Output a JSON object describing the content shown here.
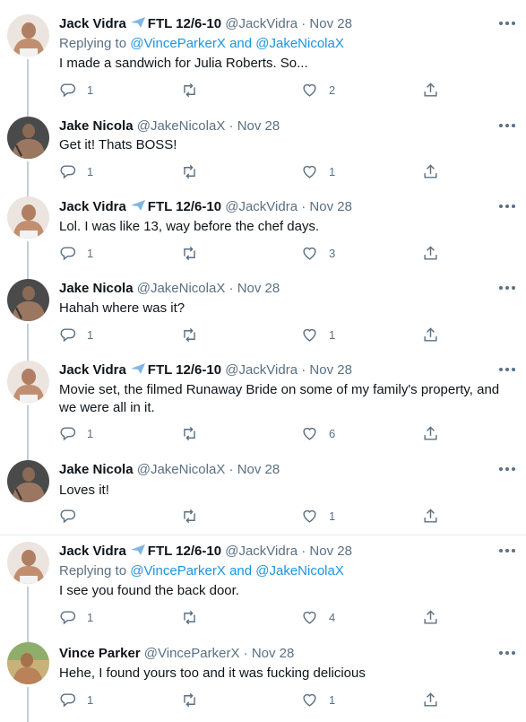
{
  "tweets": [
    {
      "name": "Jack Vidra",
      "name_suffix": "FTL 12/6-10",
      "has_plane": true,
      "handle": "@JackVidra",
      "date": "Nov 28",
      "replying_prefix": "Replying to",
      "replying_a": "@VinceParkerX",
      "replying_and": "and",
      "replying_b": "@JakeNicolaX",
      "text": "I made a sandwich for Julia Roberts. So...",
      "replies": "1",
      "retweets": "",
      "likes": "2"
    },
    {
      "name": "Jake Nicola",
      "handle": "@JakeNicolaX",
      "date": "Nov 28",
      "text": "Get it! Thats BOSS!",
      "replies": "1",
      "retweets": "",
      "likes": "1"
    },
    {
      "name": "Jack Vidra",
      "name_suffix": "FTL 12/6-10",
      "has_plane": true,
      "handle": "@JackVidra",
      "date": "Nov 28",
      "text": "Lol. I was like 13, way before the chef days.",
      "replies": "1",
      "retweets": "",
      "likes": "3"
    },
    {
      "name": "Jake Nicola",
      "handle": "@JakeNicolaX",
      "date": "Nov 28",
      "text": "Hahah where was it?",
      "replies": "1",
      "retweets": "",
      "likes": "1"
    },
    {
      "name": "Jack Vidra",
      "name_suffix": "FTL 12/6-10",
      "has_plane": true,
      "handle": "@JackVidra",
      "date": "Nov 28",
      "text": "Movie set, the filmed Runaway Bride on some of my family's property, and we were all in it.",
      "replies": "1",
      "retweets": "",
      "likes": "6"
    },
    {
      "name": "Jake Nicola",
      "handle": "@JakeNicolaX",
      "date": "Nov 28",
      "text": "Loves it!",
      "replies": "",
      "retweets": "",
      "likes": "1"
    },
    {
      "name": "Jack Vidra",
      "name_suffix": "FTL 12/6-10",
      "has_plane": true,
      "handle": "@JackVidra",
      "date": "Nov 28",
      "replying_prefix": "Replying to",
      "replying_a": "@VinceParkerX",
      "replying_and": "and",
      "replying_b": "@JakeNicolaX",
      "text": "I see you found the back door.",
      "replies": "1",
      "retweets": "",
      "likes": "4"
    },
    {
      "name": "Vince Parker",
      "handle": "@VinceParkerX",
      "date": "Nov 28",
      "text": "Hehe, I found yours too and it was fucking delicious",
      "replies": "1",
      "retweets": "",
      "likes": "1"
    }
  ],
  "separator_dot": "·",
  "colors": {
    "text": "#0f1419",
    "muted": "#5b7083",
    "link": "#1b95e0",
    "line": "#c4cfd6",
    "divider": "#e6ecf0"
  }
}
